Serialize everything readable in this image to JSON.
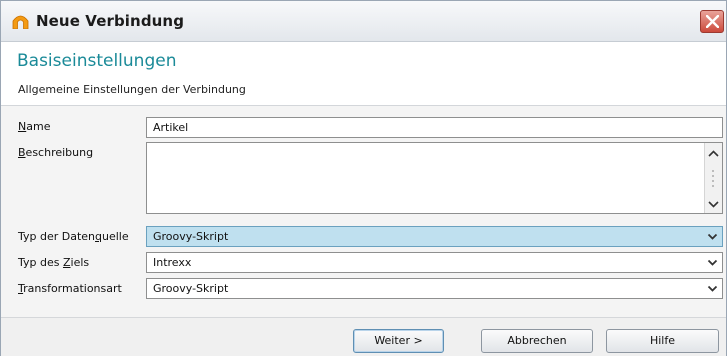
{
  "window": {
    "title": "Neue Verbindung",
    "close_icon": "close-x-icon",
    "app_icon": "connection-arch-icon",
    "accent": "#1a8a98"
  },
  "header": {
    "title": "Basiseinstellungen",
    "subtitle": "Allgemeine Einstellungen der Verbindung"
  },
  "form": {
    "name": {
      "label_pre": "",
      "label_ul": "N",
      "label_post": "ame",
      "value": "Artikel"
    },
    "description": {
      "label_pre": "",
      "label_ul": "B",
      "label_post": "eschreibung",
      "value": ""
    },
    "source_type": {
      "label_pre": "Typ der Daten",
      "label_ul": "q",
      "label_post": "uelle",
      "value": "Groovy-Skript"
    },
    "target_type": {
      "label_pre": "Typ des ",
      "label_ul": "Z",
      "label_post": "iels",
      "value": "Intrexx"
    },
    "transform_type": {
      "label_pre": "",
      "label_ul": "T",
      "label_post": "ransformationsart",
      "value": "Groovy-Skript"
    }
  },
  "buttons": {
    "next": "Weiter >",
    "cancel": "Abbrechen",
    "help": "Hilfe"
  }
}
